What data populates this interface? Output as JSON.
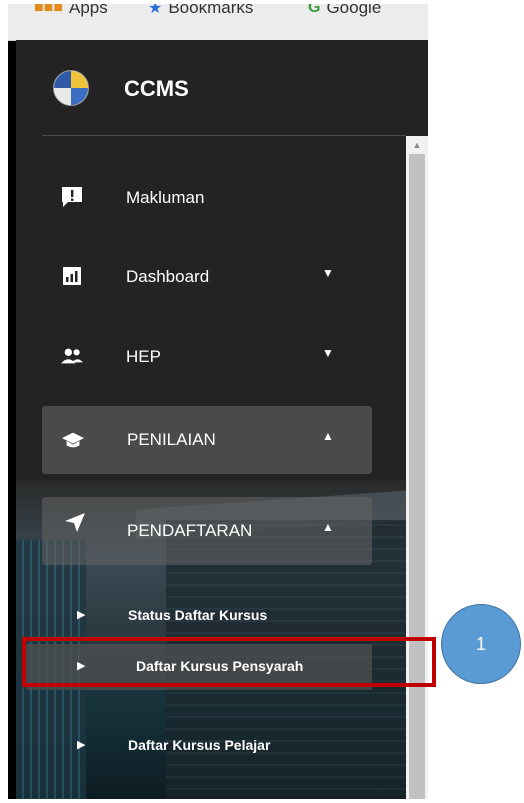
{
  "bookmarks": {
    "apps_label": "Apps",
    "bookmarks_label": "Bookmarks",
    "google_label": "Google",
    "apps_icon": "apps-grid-icon",
    "bookmarks_icon": "star-icon",
    "google_icon": "google-logo-icon"
  },
  "app": {
    "title": "CCMS",
    "logo": "ccms-logo"
  },
  "nav": {
    "items": [
      {
        "label": "Makluman",
        "icon": "alert-message-icon"
      },
      {
        "label": "Dashboard",
        "icon": "dashboard-chart-icon",
        "caret": "down"
      },
      {
        "label": "HEP",
        "icon": "people-group-icon",
        "caret": "down"
      },
      {
        "label": "PENILAIAN",
        "icon": "graduation-cap-icon",
        "caret": "up"
      },
      {
        "label": "PENDAFTARAN",
        "icon": "send-arrow-icon",
        "caret": "up"
      }
    ],
    "subitems": [
      {
        "label": "Status Daftar Kursus"
      },
      {
        "label": "Daftar Kursus Pensyarah"
      },
      {
        "label": "Daftar Kursus Pelajar"
      }
    ]
  },
  "callout": {
    "number": "1"
  },
  "colors": {
    "sidebar_bg": "#232323",
    "active_bg": "#4a4a4a",
    "callout_red": "#c00000",
    "callout_blue": "#5b9bd5"
  }
}
